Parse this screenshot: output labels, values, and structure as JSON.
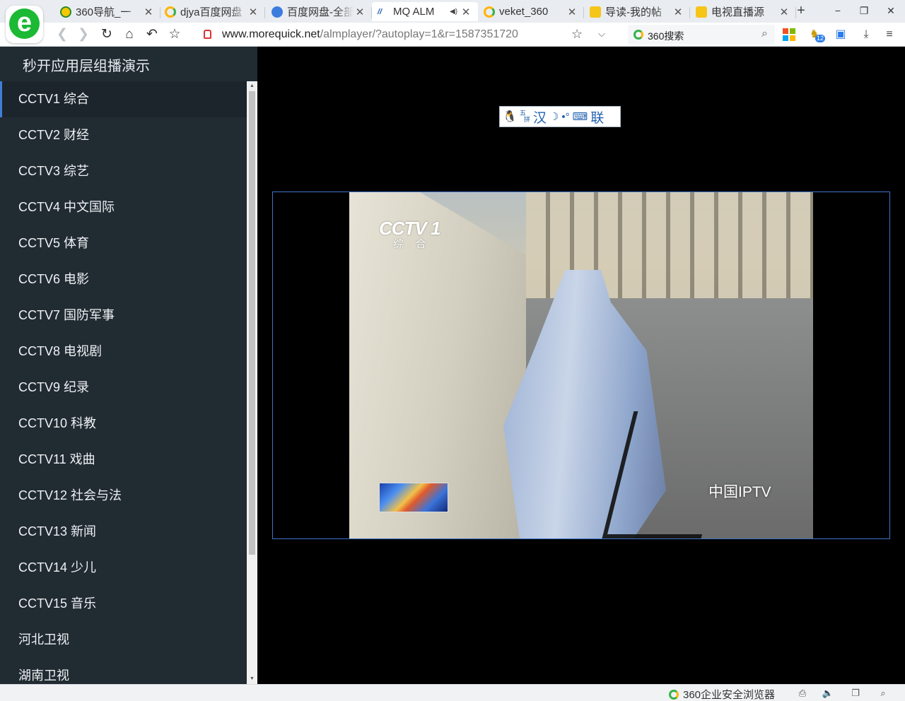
{
  "browser": {
    "tabs": [
      {
        "label": "360导航_一",
        "icon": "360-nav-icon",
        "active": false
      },
      {
        "label": "djya百度网盘",
        "icon": "360-search-icon",
        "active": false
      },
      {
        "label": "百度网盘-全部",
        "icon": "baidu-pan-icon",
        "active": false
      },
      {
        "label": "MQ ALM",
        "icon": "mq-logo-icon",
        "active": true,
        "audio": true
      },
      {
        "label": "veket_360",
        "icon": "360-search-icon",
        "active": false
      },
      {
        "label": "导读-我的帖",
        "icon": "bookmark-icon",
        "active": false
      },
      {
        "label": "电视直播源",
        "icon": "bookmark-icon",
        "active": false
      }
    ],
    "new_tab": "+",
    "window_controls": {
      "minimize": "−",
      "restore": "❐",
      "close": "✕"
    },
    "address": {
      "host": "www.morequick.net",
      "path": "/almplayer/?autoplay=1&r=1587351720"
    },
    "search": {
      "text": "360搜索"
    },
    "colors": {
      "brand_green": "#1bb934",
      "accent_blue": "#3f7fd8"
    }
  },
  "sidebar": {
    "title": "秒开应用层组播演示",
    "active_index": 0,
    "channels": [
      "CCTV1 综合",
      "CCTV2 财经",
      "CCTV3 综艺",
      "CCTV4 中文国际",
      "CCTV5 体育",
      "CCTV6 电影",
      "CCTV7 国防军事",
      "CCTV8 电视剧",
      "CCTV9 纪录",
      "CCTV10 科教",
      "CCTV11 戏曲",
      "CCTV12 社会与法",
      "CCTV13 新闻",
      "CCTV14 少儿",
      "CCTV15 音乐",
      "河北卫视",
      "湖南卫视"
    ]
  },
  "ime": {
    "sup": "五",
    "sub": "拼",
    "lang": "汉",
    "moon": "☽",
    "punct": "•°",
    "keyboard": "⌨",
    "lian": "联"
  },
  "video": {
    "logo": "CCTV 1",
    "logo_sub": "综 合",
    "watermark": "中国IPTV"
  },
  "status": {
    "brand": "360企业安全浏览器"
  }
}
